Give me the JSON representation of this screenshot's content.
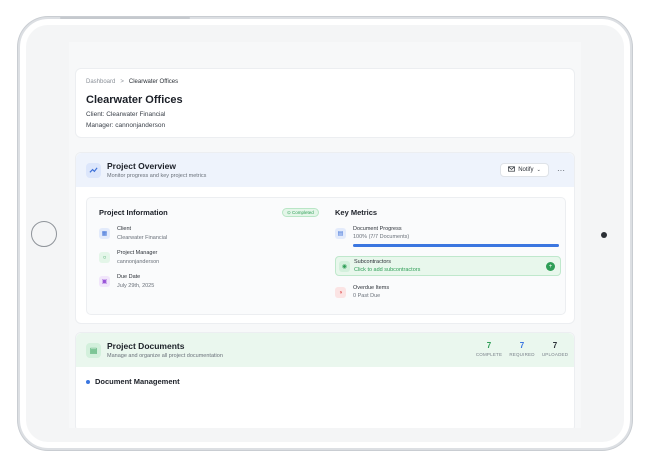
{
  "breadcrumb": {
    "root": "Dashboard",
    "separator": ">",
    "current": "Clearwater Offices"
  },
  "project": {
    "title": "Clearwater Offices",
    "client_line": "Client: Clearwater Financial",
    "manager_line": "Manager: cannonjanderson"
  },
  "overview": {
    "icon": "trending-up-icon",
    "title": "Project Overview",
    "subtitle": "Monitor progress and key project metrics",
    "notify_label": "Notify",
    "more_label": "···",
    "info_heading": "Project Information",
    "status_badge": "⊙ Completed",
    "info": [
      {
        "label": "Client",
        "value": "Clearwater Financial",
        "icon": "building-icon"
      },
      {
        "label": "Project Manager",
        "value": "cannonjanderson",
        "icon": "user-icon"
      },
      {
        "label": "Due Date",
        "value": "July 29th, 2025",
        "icon": "calendar-icon"
      }
    ],
    "metrics_heading": "Key Metrics",
    "metrics": {
      "progress_label": "Document Progress",
      "progress_value": "100% (7/7 Documents)",
      "progress_fraction": 1.0,
      "subcontractors_label": "Subcontractors",
      "subcontractors_value": "Click to add subcontractors",
      "overdue_label": "Overdue Items",
      "overdue_value": "0 Past Due"
    }
  },
  "documents": {
    "title": "Project Documents",
    "subtitle": "Manage and organize all project documentation",
    "stats": [
      {
        "value": "7",
        "label": "COMPLETE",
        "color": "#2f9e57"
      },
      {
        "value": "7",
        "label": "REQUIRED",
        "color": "#3b76e0"
      },
      {
        "value": "7",
        "label": "UPLOADED",
        "color": "#2c3138"
      }
    ],
    "management_heading": "Document Management"
  },
  "colors": {
    "accent_blue": "#3b76e0",
    "accent_green": "#2f9e57",
    "danger": "#e05454"
  }
}
